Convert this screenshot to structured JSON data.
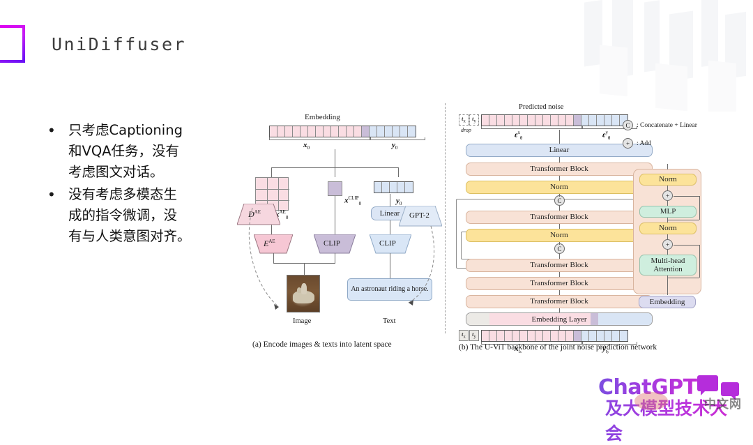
{
  "slide": {
    "title": "UniDiffuser",
    "logo_icon": "gradient-square-icon",
    "accent_from": "#e000f0",
    "accent_to": "#6a10f5"
  },
  "bullets": [
    {
      "marker": "•",
      "lines": [
        "只考虑Captioning",
        "和VQA任务，没有",
        "考虑图文对话。"
      ]
    },
    {
      "marker": "•",
      "lines": [
        "没有考虑多模态生",
        "成的指令微调，没",
        "有与人类意图对齐。"
      ]
    }
  ],
  "figure": {
    "panel_a": {
      "caption": "(a) Encode images & texts into latent space",
      "embedding_title": "Embedding",
      "token_labels": {
        "x0": "x",
        "x0_sub": "0",
        "y0": "y",
        "y0_sub": "0"
      },
      "x0_clip_label": "x",
      "x0_clip_sup": "CLIP",
      "x0_clip_sub": "0",
      "y0_mid_label": "y",
      "y0_mid_sub": "0",
      "x0_ae_label": "x",
      "x0_ae_sup": "AE",
      "x0_ae_sub": "0",
      "blocks": {
        "decoder_ae": "D",
        "decoder_ae_sup": "AE",
        "encoder_ae": "E",
        "encoder_ae_sup": "AE",
        "clip_image": "CLIP",
        "clip_text": "CLIP",
        "gpt2": "GPT-2",
        "linear": "Linear"
      },
      "image_caption": "Image",
      "text_caption": "Text",
      "prompt_text": "An astronaut riding a horse.",
      "tokens_pink": 12,
      "tokens_purple": 1,
      "tokens_blue": 6,
      "tokens_y_mid": 5
    },
    "panel_b": {
      "caption": "(b) The U-ViT backbone of the joint noise prediction network",
      "predicted_noise_title": "Predicted noise",
      "drop_label": "drop",
      "t_x_label": "t",
      "t_x_sub": "x",
      "t_y_label": "t",
      "t_y_sub": "y",
      "eps_x": "ε",
      "eps_x_sub": "θ",
      "eps_x_sup": "x",
      "eps_y": "ε",
      "eps_y_sub": "θ",
      "eps_y_sup": "y",
      "bottom_x_label": "x",
      "bottom_x_sub": "t",
      "bottom_x_sub2": "x",
      "bottom_y_label": "y",
      "bottom_y_sub": "t",
      "bottom_y_sub2": "y",
      "stack": [
        {
          "label": "Linear",
          "color": "blue"
        },
        {
          "label": "Transformer Block",
          "color": "peach"
        },
        {
          "label": "Norm",
          "color": "yellow"
        },
        {
          "label": "Transformer Block",
          "color": "peach"
        },
        {
          "label": "Norm",
          "color": "yellow"
        },
        {
          "label": "Transformer Block",
          "color": "peach"
        },
        {
          "label": "Transformer Block",
          "color": "peach"
        },
        {
          "label": "Transformer Block",
          "color": "peach"
        },
        {
          "label": "Embedding Layer",
          "color": "white"
        }
      ],
      "concat_symbol": "C",
      "tokens_pink": 12,
      "tokens_purple": 1,
      "tokens_blue": 6
    },
    "detail": {
      "blocks": [
        {
          "label": "Norm",
          "color": "yellow"
        },
        {
          "label": "MLP",
          "color": "mint"
        },
        {
          "label": "Norm",
          "color": "yellow"
        },
        {
          "label": "Multi-head Attention",
          "color": "mint"
        }
      ],
      "embedding_label": "Embedding",
      "add_symbol": "+"
    },
    "legend": [
      {
        "symbol": "C",
        "text": ": Concatenate + Linear"
      },
      {
        "symbol": "+",
        "text": ": Add"
      }
    ]
  },
  "conference_logo": {
    "line1": "ChatGPT",
    "line2": "及大模型技术大会",
    "watermark": "中文网"
  }
}
